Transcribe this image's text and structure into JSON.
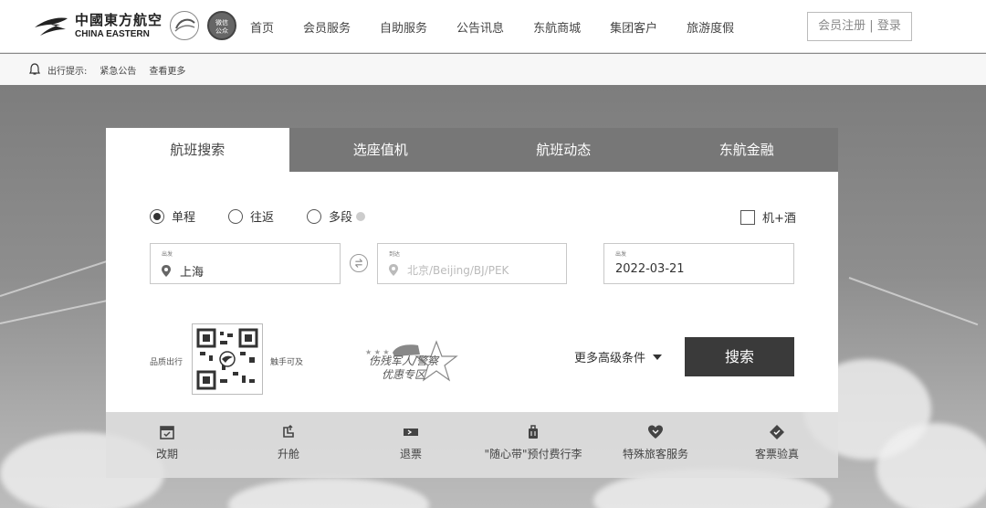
{
  "header": {
    "logo_cn": "中國東方航空",
    "logo_en": "CHINA EASTERN",
    "gov_badge": "微信\n公众",
    "nav": [
      "首页",
      "会员服务",
      "自助服务",
      "公告讯息",
      "东航商城",
      "集团客户",
      "旅游度假"
    ],
    "login": "会员注册 | 登录"
  },
  "notice": {
    "label": "出行提示:",
    "urgent": "紧急公告",
    "more": "查看更多"
  },
  "tabs": [
    "航班搜索",
    "选座值机",
    "航班动态",
    "东航金融"
  ],
  "trip_types": [
    "单程",
    "往返",
    "多段"
  ],
  "hotel_combo": "机+酒",
  "from": {
    "label": "出发",
    "value": "上海"
  },
  "to": {
    "label": "到达",
    "placeholder": "北京/Beijing/BJ/PEK"
  },
  "date": {
    "label": "出发",
    "value": "2022-03-21"
  },
  "qr": {
    "left_label": "品质出行",
    "right_label": "触手可及"
  },
  "promo": {
    "line1": "伤残军人/警察",
    "line2": "优惠专区"
  },
  "more_conditions": "更多高级条件",
  "search": "搜索",
  "services": [
    "改期",
    "升舱",
    "退票",
    "\"随心带\"预付费行李",
    "特殊旅客服务",
    "客票验真"
  ],
  "colors": {
    "tab_bar": "#777777",
    "search_button": "#3a3a3a"
  }
}
